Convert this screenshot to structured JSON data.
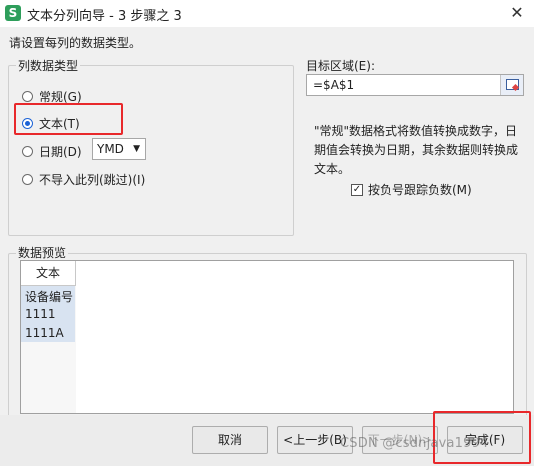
{
  "window": {
    "title": "文本分列向导 - 3 步骤之 3",
    "app_icon_letter": "S",
    "close_glyph": "✕"
  },
  "instruction": "请设置每列的数据类型。",
  "column_type_group": {
    "title": "列数据类型",
    "options": [
      {
        "label": "常规(G)",
        "checked": false
      },
      {
        "label": "文本(T)",
        "checked": true
      },
      {
        "label": "日期(D)",
        "checked": false
      },
      {
        "label": "不导入此列(跳过)(I)",
        "checked": false
      }
    ],
    "date_format": "YMD"
  },
  "target": {
    "label": "目标区域(E):",
    "value": "=$A$1"
  },
  "description": "\"常规\"数据格式将数值转换成数字，日期值会转换为日期，其余数据则转换成文本。",
  "negative_checkbox": {
    "label": "按负号跟踪负数(M)",
    "checked": true,
    "check_glyph": "✓"
  },
  "preview": {
    "title": "数据预览",
    "header": "文本",
    "rows": [
      "设备编号",
      "1111",
      "1111A"
    ]
  },
  "buttons": {
    "cancel": "取消",
    "back": "<上一步(B)",
    "next": "下一步(N)>",
    "finish": "完成(F)"
  },
  "watermark": "CSDN @csdnjava1994",
  "colors": {
    "highlight": "#e8282b",
    "accent": "#1c63d6",
    "app_icon": "#2e9e5b"
  }
}
